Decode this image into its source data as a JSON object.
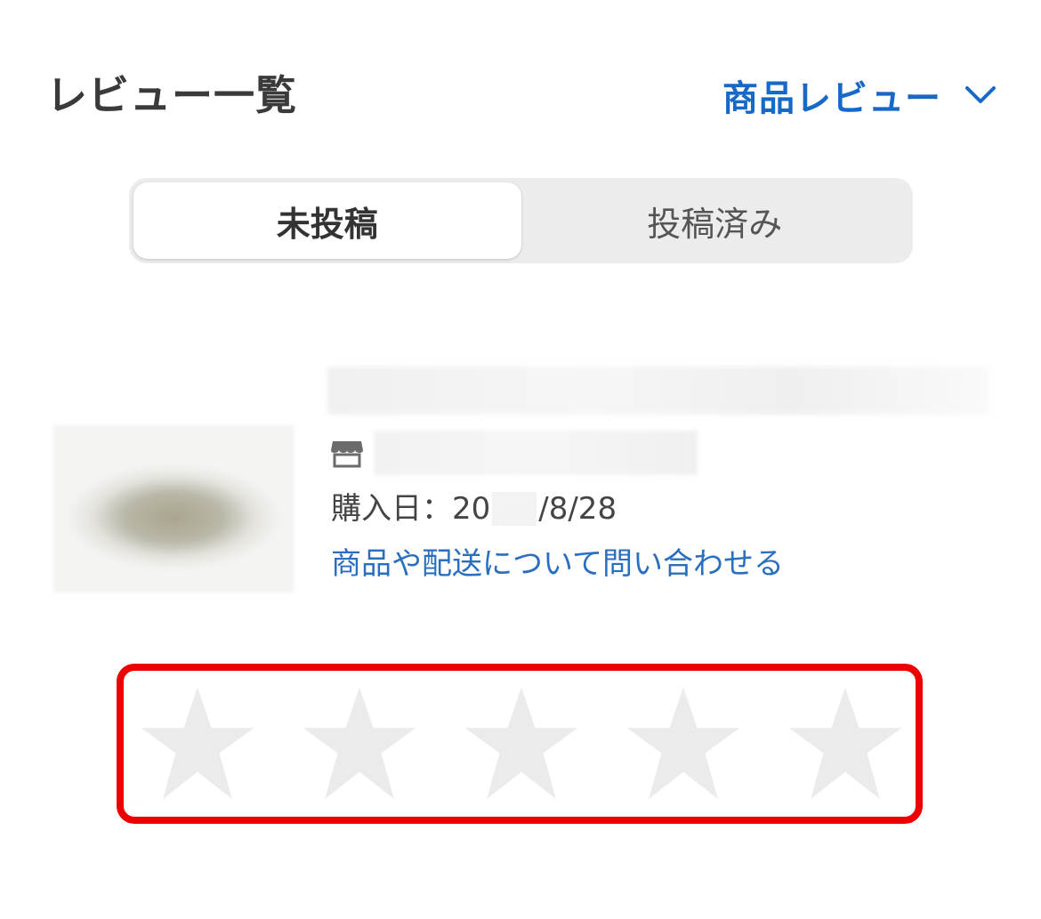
{
  "header": {
    "title": "レビュー一覧",
    "review_type": "商品レビュー"
  },
  "tabs": [
    {
      "label": "未投稿",
      "active": true
    },
    {
      "label": "投稿済み",
      "active": false
    }
  ],
  "item": {
    "purchase_date_label": "購入日：",
    "purchase_date_prefix": "20",
    "purchase_date_suffix": "/8/28",
    "inquiry_link": "商品や配送について問い合わせる"
  },
  "rating": {
    "stars_total": 5,
    "stars_selected": 0,
    "star_empty_color": "#ebebeb",
    "highlight_color": "#ee0000"
  },
  "colors": {
    "accent_blue": "#1769c7",
    "link_blue": "#2a6fbf"
  },
  "icons": {
    "dropdown": "chevron-down-icon",
    "shop": "shop-icon",
    "star": "star-icon"
  }
}
